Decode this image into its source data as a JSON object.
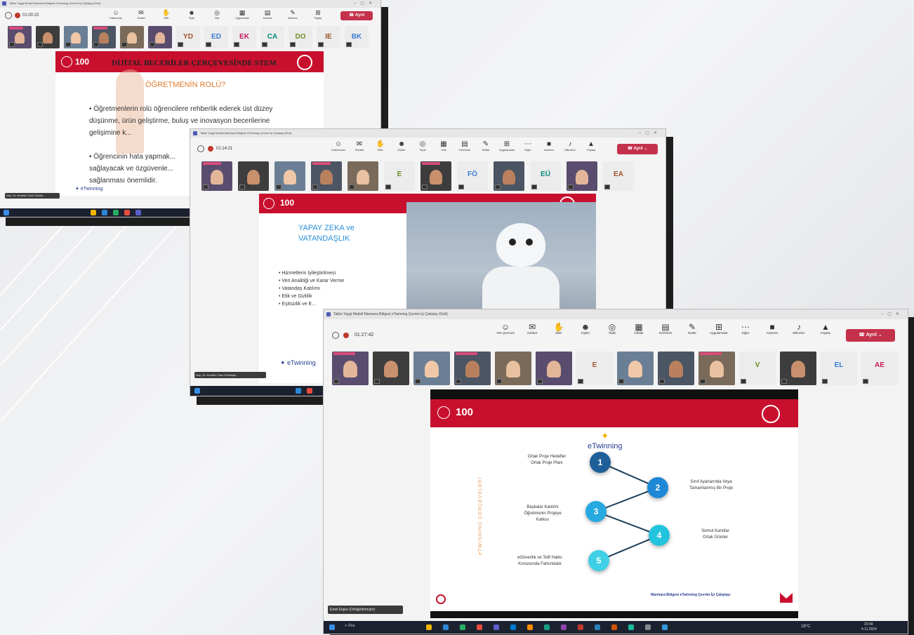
{
  "win1": {
    "title": "Talkin Yaygi Modell Marmara Bölgesi eTwinning Çevrim İçi Çalıştay (Gizli)",
    "timer": "01:00:23",
    "tools": [
      "Katılımcılar",
      "Sohbet",
      "Eller",
      "Tepki",
      "Oda",
      "Uygulamalar",
      "Kamera",
      "Mikrofon",
      "Paylaş"
    ],
    "leave": "Ayrıl",
    "slide": {
      "title": "DİJİTAL BECERİLER ÇERÇEVESİNDE STEM",
      "subtitle": "ÖĞRETMENİN ROLÜ?",
      "bullet1": "• Öğretmenlerin rolü öğrencilere rehberlik ederek üst düzey düşünme, ürün geliştirme, buluş ve inovasyon becerilerine gelişimine k...",
      "bullet2": "• Öğrencinin hata yapmak... sağlayacak ve özgüvenle... sağlanması önemlidir.",
      "brand": "eTwinning"
    },
    "tiles": [
      "",
      "",
      "",
      "",
      "",
      "",
      "YD",
      "ED",
      "EK",
      "CA",
      "DO",
      "IE",
      "BK"
    ]
  },
  "win2": {
    "title": "Talkin Yaygi Modell Marmara Bölgesi eTwinning Çevrim İçi Çalıştay (Gizli)",
    "timer": "01:14:21",
    "tools": [
      "Katılımcılar",
      "Sohbet",
      "Eller",
      "Kişiler",
      "Tepki",
      "Oda",
      "Görünüm",
      "Notlar",
      "Uygulamalar",
      "Diğer",
      "Kamera",
      "Mikrofon",
      "Paylaş"
    ],
    "leave": "Ayrıl",
    "slide": {
      "title": "YAPAY ZEKA ve VATANDAŞLIK",
      "bullets": [
        "• Hizmetlerin İyileştirilmesi",
        "• Veri Analitiği ve Karar Verme",
        "• Vatandaş Katılımı",
        "• Etik ve Gizlilik",
        "• Eşitsizlik ve E..."
      ],
      "brand": "eTwinning"
    },
    "tiles": [
      "",
      "",
      "",
      "",
      "",
      "E",
      "",
      "FÖ",
      "",
      "EÜ",
      "",
      "EA"
    ],
    "name_chip": "Doç. Dr. Nurettin Tarık Öztürkalp..."
  },
  "win3": {
    "title": "Talkin Yaygi Modell Marmara Bölgesi eTwinning Çevrim İçi Çalıştay (Gizli)",
    "timer": "01:27:42",
    "tools": [
      "Yeni pencere",
      "Sohbet",
      "Eller",
      "Kişiler",
      "Tepki",
      "Odalar",
      "Görünüm",
      "Notlar",
      "Uygulamalar",
      "Diğer",
      "Kamera",
      "Mikrofon",
      "Paylaş"
    ],
    "leave": "Ayrıl",
    "tiles": [
      "",
      "",
      "",
      "",
      "",
      "",
      "E",
      "",
      "",
      "",
      "V",
      "",
      "EL",
      "AE"
    ],
    "slide": {
      "brand": "eTwinning",
      "vertical": "eTWINNING ÇERÇEVELERİ",
      "nodes": [
        "1",
        "2",
        "3",
        "4",
        "5"
      ],
      "labels": [
        "Ortak Proje Hedefler\nOrtak Proje Planı",
        "Sınıf Ayarlarında Veya\nTamamlanmış Bir Proje",
        "Başkalar Katılımı\nÖğretmenin Projeye\nKatkısı",
        "Somut Kanıtlar\nOrtak Ürünler",
        "eGüvenlik ve Telif Hakkı\nKonusunda Farkındalık"
      ],
      "footer": "Marmara Bölgesi eTwinning Çevrim İçi Çalıştayı"
    },
    "name_chip": "Emel Ergun (Ortağıtılırmıştır)",
    "taskbar": {
      "weather": "18°C",
      "time": "23:49",
      "date": "4.11.2024",
      "search": "Ara"
    }
  }
}
